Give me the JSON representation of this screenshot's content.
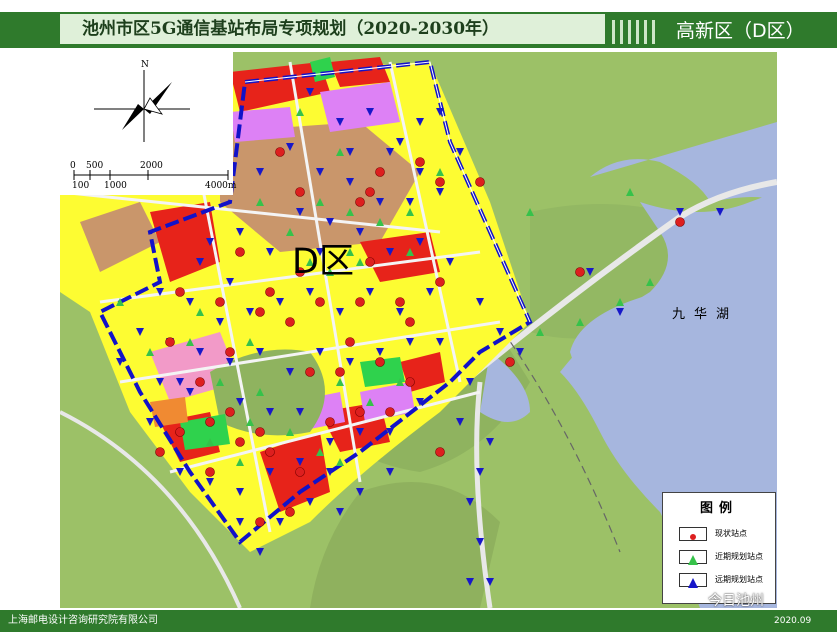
{
  "header": {
    "title": "池州市区5G通信基站布局专项规划（2020-2030年）",
    "district": "高新区（D区）"
  },
  "map": {
    "district_label": "D区",
    "lake_label": "九华湖",
    "scale_ticks_top": [
      "0",
      "500",
      "2000"
    ],
    "scale_ticks_bottom": [
      "100",
      "1000",
      "4000m"
    ],
    "north_label": "N",
    "colors": {
      "green_space": "#9cc167",
      "residential": "#fdfc32",
      "commercial": "#e7231a",
      "education": "#dd81f5",
      "brown": "#c9966b",
      "boundary": "#1212c8",
      "water": "#a6b6de"
    }
  },
  "legend": {
    "title": "图例",
    "items": [
      {
        "label": "现状站点",
        "symbol": "red-circle-icon",
        "color": "#dd1f1f"
      },
      {
        "label": "近期规划站点",
        "symbol": "green-triangle-icon",
        "color": "#36c24a"
      },
      {
        "label": "远期规划站点",
        "symbol": "blue-triangle-icon",
        "color": "#1717c9"
      }
    ]
  },
  "footer": {
    "org": "上海邮电设计咨询研究院有限公司",
    "date": "2020.09"
  },
  "watermark": {
    "text": "今日池州"
  }
}
